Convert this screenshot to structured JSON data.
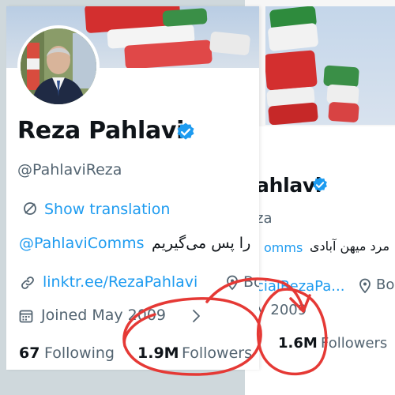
{
  "colors": {
    "link_blue": "#1d9bf0",
    "text_primary": "#0f1419",
    "text_secondary": "#536471",
    "annotation_red": "#e53935",
    "flag_green": "#2e8b3d",
    "flag_red": "#d32f2f"
  },
  "icons": {
    "verified": "verified-badge-icon",
    "translate": "translate-icon",
    "link": "link-icon",
    "location": "location-pin-icon",
    "calendar": "calendar-icon",
    "chevron": "chevron-right-icon"
  },
  "front_profile": {
    "display_name": "Reza Pahlavi",
    "handle": "@PahlaviReza",
    "show_translation": "Show translation",
    "bio_mention": "@PahlaviComms",
    "bio_text": "را پس می‌گیریم",
    "website": "linktr.ee/RezaPahlavi",
    "location": "Bo",
    "joined": "Joined May 2009",
    "following_count": "67",
    "following_label": "Following",
    "followers_count": "1.9M",
    "followers_label": "Followers"
  },
  "back_profile": {
    "display_name": "ahlavi",
    "handle": "za",
    "bio_mention": "omms",
    "bio_text": "مرد میهن آبادی",
    "website": "cialRezaPa...",
    "location": "Bo",
    "joined": "y 2009",
    "followers_count": "1.6M",
    "followers_label": "Followers"
  }
}
